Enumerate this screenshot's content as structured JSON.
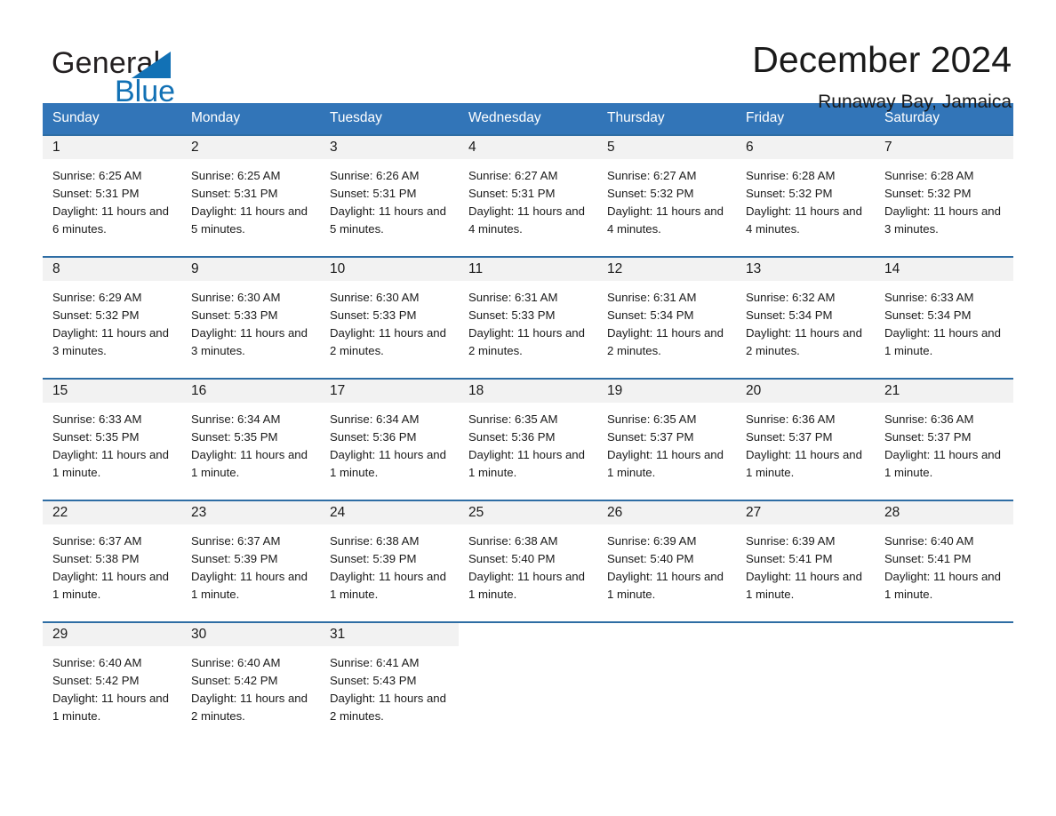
{
  "brand": {
    "name_part1": "General",
    "name_part2": "Blue",
    "accent_color": "#1271b5"
  },
  "header": {
    "title": "December 2024",
    "location": "Runaway Bay, Jamaica"
  },
  "calendar": {
    "header_bg": "#3275b8",
    "row_border_color": "#2e6da4",
    "daynum_bg": "#f2f2f2",
    "weekdays": [
      "Sunday",
      "Monday",
      "Tuesday",
      "Wednesday",
      "Thursday",
      "Friday",
      "Saturday"
    ],
    "labels": {
      "sunrise": "Sunrise:",
      "sunset": "Sunset:",
      "daylight": "Daylight:"
    },
    "weeks": [
      [
        {
          "day": "1",
          "sunrise": "Sunrise: 6:25 AM",
          "sunset": "Sunset: 5:31 PM",
          "daylight": "Daylight: 11 hours and 6 minutes."
        },
        {
          "day": "2",
          "sunrise": "Sunrise: 6:25 AM",
          "sunset": "Sunset: 5:31 PM",
          "daylight": "Daylight: 11 hours and 5 minutes."
        },
        {
          "day": "3",
          "sunrise": "Sunrise: 6:26 AM",
          "sunset": "Sunset: 5:31 PM",
          "daylight": "Daylight: 11 hours and 5 minutes."
        },
        {
          "day": "4",
          "sunrise": "Sunrise: 6:27 AM",
          "sunset": "Sunset: 5:31 PM",
          "daylight": "Daylight: 11 hours and 4 minutes."
        },
        {
          "day": "5",
          "sunrise": "Sunrise: 6:27 AM",
          "sunset": "Sunset: 5:32 PM",
          "daylight": "Daylight: 11 hours and 4 minutes."
        },
        {
          "day": "6",
          "sunrise": "Sunrise: 6:28 AM",
          "sunset": "Sunset: 5:32 PM",
          "daylight": "Daylight: 11 hours and 4 minutes."
        },
        {
          "day": "7",
          "sunrise": "Sunrise: 6:28 AM",
          "sunset": "Sunset: 5:32 PM",
          "daylight": "Daylight: 11 hours and 3 minutes."
        }
      ],
      [
        {
          "day": "8",
          "sunrise": "Sunrise: 6:29 AM",
          "sunset": "Sunset: 5:32 PM",
          "daylight": "Daylight: 11 hours and 3 minutes."
        },
        {
          "day": "9",
          "sunrise": "Sunrise: 6:30 AM",
          "sunset": "Sunset: 5:33 PM",
          "daylight": "Daylight: 11 hours and 3 minutes."
        },
        {
          "day": "10",
          "sunrise": "Sunrise: 6:30 AM",
          "sunset": "Sunset: 5:33 PM",
          "daylight": "Daylight: 11 hours and 2 minutes."
        },
        {
          "day": "11",
          "sunrise": "Sunrise: 6:31 AM",
          "sunset": "Sunset: 5:33 PM",
          "daylight": "Daylight: 11 hours and 2 minutes."
        },
        {
          "day": "12",
          "sunrise": "Sunrise: 6:31 AM",
          "sunset": "Sunset: 5:34 PM",
          "daylight": "Daylight: 11 hours and 2 minutes."
        },
        {
          "day": "13",
          "sunrise": "Sunrise: 6:32 AM",
          "sunset": "Sunset: 5:34 PM",
          "daylight": "Daylight: 11 hours and 2 minutes."
        },
        {
          "day": "14",
          "sunrise": "Sunrise: 6:33 AM",
          "sunset": "Sunset: 5:34 PM",
          "daylight": "Daylight: 11 hours and 1 minute."
        }
      ],
      [
        {
          "day": "15",
          "sunrise": "Sunrise: 6:33 AM",
          "sunset": "Sunset: 5:35 PM",
          "daylight": "Daylight: 11 hours and 1 minute."
        },
        {
          "day": "16",
          "sunrise": "Sunrise: 6:34 AM",
          "sunset": "Sunset: 5:35 PM",
          "daylight": "Daylight: 11 hours and 1 minute."
        },
        {
          "day": "17",
          "sunrise": "Sunrise: 6:34 AM",
          "sunset": "Sunset: 5:36 PM",
          "daylight": "Daylight: 11 hours and 1 minute."
        },
        {
          "day": "18",
          "sunrise": "Sunrise: 6:35 AM",
          "sunset": "Sunset: 5:36 PM",
          "daylight": "Daylight: 11 hours and 1 minute."
        },
        {
          "day": "19",
          "sunrise": "Sunrise: 6:35 AM",
          "sunset": "Sunset: 5:37 PM",
          "daylight": "Daylight: 11 hours and 1 minute."
        },
        {
          "day": "20",
          "sunrise": "Sunrise: 6:36 AM",
          "sunset": "Sunset: 5:37 PM",
          "daylight": "Daylight: 11 hours and 1 minute."
        },
        {
          "day": "21",
          "sunrise": "Sunrise: 6:36 AM",
          "sunset": "Sunset: 5:37 PM",
          "daylight": "Daylight: 11 hours and 1 minute."
        }
      ],
      [
        {
          "day": "22",
          "sunrise": "Sunrise: 6:37 AM",
          "sunset": "Sunset: 5:38 PM",
          "daylight": "Daylight: 11 hours and 1 minute."
        },
        {
          "day": "23",
          "sunrise": "Sunrise: 6:37 AM",
          "sunset": "Sunset: 5:39 PM",
          "daylight": "Daylight: 11 hours and 1 minute."
        },
        {
          "day": "24",
          "sunrise": "Sunrise: 6:38 AM",
          "sunset": "Sunset: 5:39 PM",
          "daylight": "Daylight: 11 hours and 1 minute."
        },
        {
          "day": "25",
          "sunrise": "Sunrise: 6:38 AM",
          "sunset": "Sunset: 5:40 PM",
          "daylight": "Daylight: 11 hours and 1 minute."
        },
        {
          "day": "26",
          "sunrise": "Sunrise: 6:39 AM",
          "sunset": "Sunset: 5:40 PM",
          "daylight": "Daylight: 11 hours and 1 minute."
        },
        {
          "day": "27",
          "sunrise": "Sunrise: 6:39 AM",
          "sunset": "Sunset: 5:41 PM",
          "daylight": "Daylight: 11 hours and 1 minute."
        },
        {
          "day": "28",
          "sunrise": "Sunrise: 6:40 AM",
          "sunset": "Sunset: 5:41 PM",
          "daylight": "Daylight: 11 hours and 1 minute."
        }
      ],
      [
        {
          "day": "29",
          "sunrise": "Sunrise: 6:40 AM",
          "sunset": "Sunset: 5:42 PM",
          "daylight": "Daylight: 11 hours and 1 minute."
        },
        {
          "day": "30",
          "sunrise": "Sunrise: 6:40 AM",
          "sunset": "Sunset: 5:42 PM",
          "daylight": "Daylight: 11 hours and 2 minutes."
        },
        {
          "day": "31",
          "sunrise": "Sunrise: 6:41 AM",
          "sunset": "Sunset: 5:43 PM",
          "daylight": "Daylight: 11 hours and 2 minutes."
        },
        {
          "day": "",
          "sunrise": "",
          "sunset": "",
          "daylight": ""
        },
        {
          "day": "",
          "sunrise": "",
          "sunset": "",
          "daylight": ""
        },
        {
          "day": "",
          "sunrise": "",
          "sunset": "",
          "daylight": ""
        },
        {
          "day": "",
          "sunrise": "",
          "sunset": "",
          "daylight": ""
        }
      ]
    ]
  }
}
